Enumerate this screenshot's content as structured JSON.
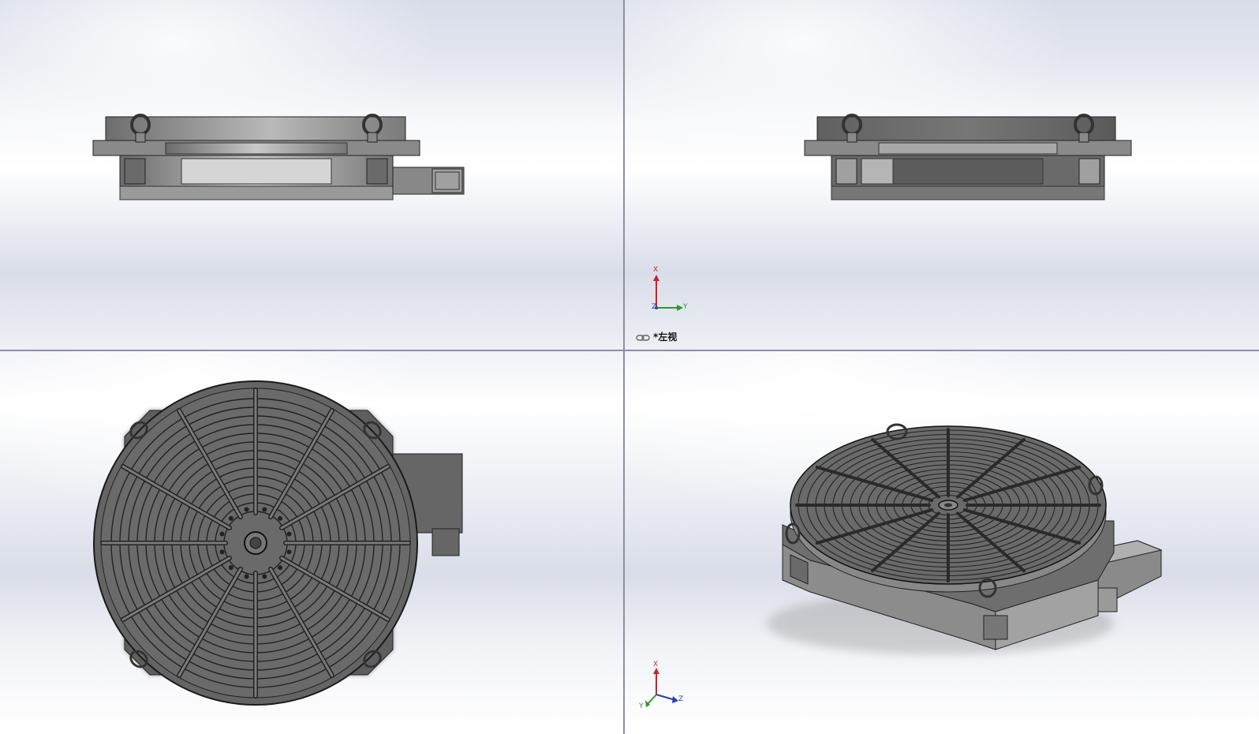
{
  "viewports": {
    "top_left": {
      "name": "front-view"
    },
    "top_right": {
      "name": "left-view",
      "label": "*左视"
    },
    "bottom_left": {
      "name": "top-view"
    },
    "bottom_right": {
      "name": "isometric-view"
    }
  },
  "triads": {
    "top_right": {
      "x_label": "X",
      "y_label": "Y",
      "z_label": "Z"
    },
    "bottom_right": {
      "x_label": "X",
      "y_label": "Y",
      "z_label": "Z"
    }
  },
  "colors": {
    "divider": "#8c8fa3",
    "part_dark": "#5a5a5a",
    "part_mid": "#7d7d7d",
    "part_light": "#b8b8b8",
    "axis_x": "#d02020",
    "axis_y": "#2a9a2a",
    "axis_z": "#2040c0"
  }
}
